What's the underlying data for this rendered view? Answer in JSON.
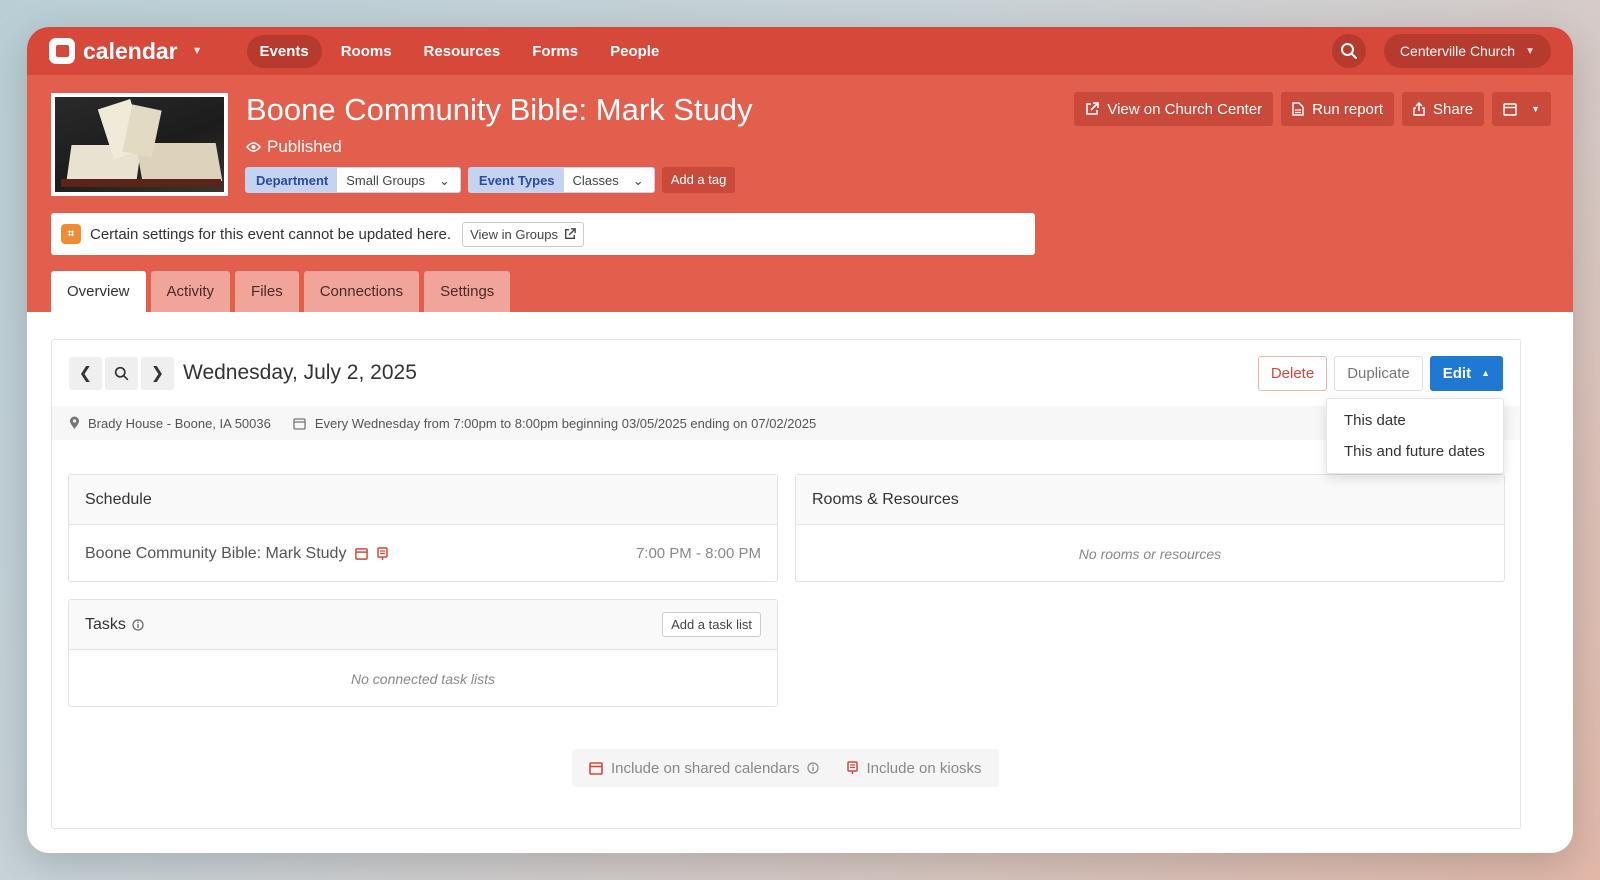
{
  "app": {
    "name": "calendar",
    "org": "Centerville Church"
  },
  "nav": [
    {
      "label": "Events",
      "active": true
    },
    {
      "label": "Rooms"
    },
    {
      "label": "Resources"
    },
    {
      "label": "Forms"
    },
    {
      "label": "People"
    }
  ],
  "event": {
    "title": "Boone Community Bible: Mark Study",
    "status": "Published",
    "tags": [
      {
        "category": "Department",
        "value": "Small Groups"
      },
      {
        "category": "Event Types",
        "value": "Classes"
      }
    ],
    "add_tag_label": "Add a tag"
  },
  "header_actions": {
    "view_church_center": "View on Church Center",
    "run_report": "Run report",
    "share": "Share"
  },
  "notice": {
    "text": "Certain settings for this event cannot be updated here.",
    "button": "View in Groups"
  },
  "tabs": [
    {
      "label": "Overview",
      "active": true
    },
    {
      "label": "Activity"
    },
    {
      "label": "Files"
    },
    {
      "label": "Connections"
    },
    {
      "label": "Settings"
    }
  ],
  "occurrence": {
    "date": "Wednesday, July 2, 2025",
    "location": "Brady House - Boone, IA 50036",
    "recurrence": "Every Wednesday from 7:00pm to 8:00pm beginning 03/05/2025 ending on 07/02/2025"
  },
  "actions": {
    "delete": "Delete",
    "duplicate": "Duplicate",
    "edit": "Edit",
    "edit_menu": [
      "This date",
      "This and future dates"
    ]
  },
  "schedule": {
    "title": "Schedule",
    "item_name": "Boone Community Bible: Mark Study",
    "item_time": "7:00 PM - 8:00 PM"
  },
  "rooms": {
    "title": "Rooms & Resources",
    "empty": "No rooms or resources"
  },
  "tasks": {
    "title": "Tasks",
    "add_button": "Add a task list",
    "empty": "No connected task lists"
  },
  "footer": {
    "shared_calendars": "Include on shared calendars",
    "kiosks": "Include on kiosks"
  },
  "colors": {
    "brand": "#d5483a",
    "header": "#e25f4d",
    "primary": "#1f78d1"
  }
}
